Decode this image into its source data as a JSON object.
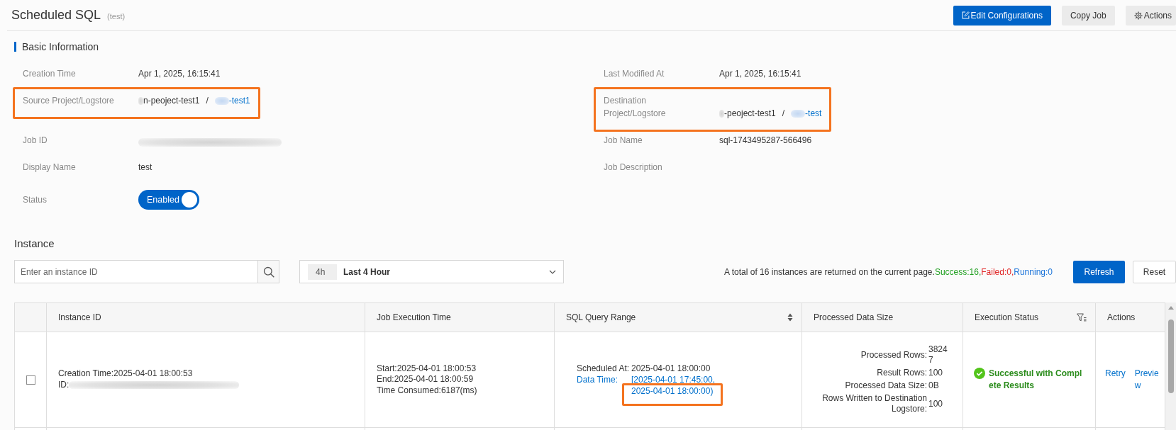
{
  "header": {
    "title": "Scheduled SQL",
    "subtitle": "(test)",
    "buttons": [
      {
        "label": "Edit Configurations",
        "kind": "edit"
      },
      {
        "label": "Copy Job",
        "kind": "copy"
      },
      {
        "label": "Actions",
        "kind": "menu"
      }
    ]
  },
  "basic_information": {
    "title": "Basic Information",
    "fields": [
      {
        "label": "Creation Time",
        "kind": "text",
        "value": "Apr 1, 2025, 16:15:41"
      },
      {
        "label": "Last Modified At",
        "kind": "text",
        "value": "Apr 1, 2025, 16:15:41"
      },
      {
        "label": "Source Project/Logstore",
        "kind": "path",
        "highlighted": true,
        "project": {
          "text": "n-peoject-test1",
          "redacted_prefix": true
        },
        "separator": "/",
        "logstore": {
          "text": "-test1",
          "redacted_prefix": true
        }
      },
      {
        "label": "Destination Project/Logstore",
        "kind": "path",
        "highlighted": true,
        "project": {
          "text": "-peoject-test1",
          "redacted_prefix": true
        },
        "separator": "/",
        "logstore": {
          "text": "-test",
          "redacted_prefix": true
        }
      },
      {
        "label": "Job ID",
        "kind": "redacted"
      },
      {
        "label": "Job Name",
        "kind": "text",
        "value": "sql-1743495287-566496"
      },
      {
        "label": "Display Name",
        "kind": "text",
        "value": "test"
      },
      {
        "label": "Job Description",
        "kind": "text"
      },
      {
        "label": "Status",
        "kind": "toggle",
        "value": "Enabled",
        "on": true
      }
    ]
  },
  "instance": {
    "title": "Instance",
    "search": {
      "placeholder": "Enter an instance ID"
    },
    "time_range": {
      "tag": "4h",
      "value": "Last 4 Hour"
    },
    "summary": {
      "text": "A total of 16 instances are returned on the current page.",
      "counts": [
        {
          "label": "Success:16,",
          "color": "#22a022"
        },
        {
          "label": "Failed:0,",
          "color": "#e02424"
        },
        {
          "label": "Running:0",
          "color": "#1a73d9"
        }
      ]
    },
    "buttons": [
      {
        "label": "Refresh",
        "kind": "primary"
      },
      {
        "label": "Reset",
        "kind": "default"
      }
    ],
    "table": {
      "columns": [
        {
          "label": "Instance ID"
        },
        {
          "label": "Job Execution Time"
        },
        {
          "label": "SQL Query Range",
          "sortable": true
        },
        {
          "label": "Processed Data Size"
        },
        {
          "label": "Execution Status",
          "filterable": true
        },
        {
          "label": "Actions"
        }
      ],
      "rows": [
        {
          "selected": false,
          "instance": {
            "creation_time": "Creation Time:2025-04-01 18:00:53",
            "id_label": "ID:",
            "id_redacted": true
          },
          "execution": [
            "Start:2025-04-01 18:00:53",
            "End:2025-04-01 18:00:59",
            "Time Consumed:6187(ms)"
          ],
          "query_range": {
            "scheduled_label": "Scheduled At:",
            "scheduled_value": "2025-04-01 18:00:00",
            "data_time_label": "Data Time:",
            "range_start": "[2025-04-01 17:45:00,",
            "range_end": "2025-04-01 18:00:00)",
            "range_end_highlighted": true
          },
          "processed": [
            {
              "label": "Processed Rows:",
              "value": "38247"
            },
            {
              "label": "Result Rows:",
              "value": "100"
            },
            {
              "label": "Processed Data Size:",
              "value": "0B"
            },
            {
              "label": "Rows Written to Destination Logstore:",
              "value": "100"
            }
          ],
          "status": {
            "kind": "success",
            "label": "Successful with Complete Results"
          },
          "actions": [
            "Retry",
            "Preview"
          ]
        }
      ]
    }
  }
}
